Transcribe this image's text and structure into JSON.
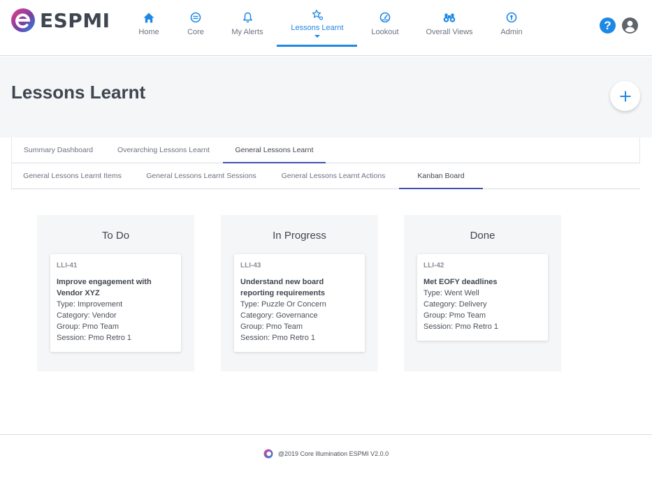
{
  "app": {
    "name": "ESPMI"
  },
  "nav": {
    "items": [
      {
        "label": "Home",
        "icon": "home-icon"
      },
      {
        "label": "Core",
        "icon": "core-icon"
      },
      {
        "label": "My Alerts",
        "icon": "bell-icon"
      },
      {
        "label": "Lessons Learnt",
        "icon": "lessons-learnt-icon",
        "active": true
      },
      {
        "label": "Lookout",
        "icon": "gauge-icon"
      },
      {
        "label": "Overall Views",
        "icon": "binoculars-icon"
      },
      {
        "label": "Admin",
        "icon": "admin-key-icon"
      }
    ],
    "help_icon": "help-icon",
    "help_glyph": "?",
    "user_icon": "user-avatar-icon"
  },
  "page": {
    "title": "Lessons Learnt",
    "add_icon": "plus-icon"
  },
  "tabs": {
    "primary": [
      "Summary Dashboard",
      "Overarching Lessons Learnt",
      "General Lessons Learnt"
    ],
    "primary_active": "General Lessons Learnt",
    "secondary": [
      "General Lessons Learnt Items",
      "General Lessons Learnt Sessions",
      "General Lessons Learnt Actions",
      "Kanban Board"
    ],
    "secondary_active": "Kanban Board"
  },
  "kanban": {
    "columns": [
      {
        "title": "To Do",
        "cards": [
          {
            "id": "LLI-41",
            "title": "Improve engagement with Vendor XYZ",
            "type": "Type: Improvement",
            "category": "Category: Vendor",
            "group": "Group: Pmo Team",
            "session": "Session: Pmo Retro 1"
          }
        ]
      },
      {
        "title": "In Progress",
        "cards": [
          {
            "id": "LLI-43",
            "title": "Understand new board reporting requirements",
            "type": "Type: Puzzle Or Concern",
            "category": "Category: Governance",
            "group": "Group: Pmo Team",
            "session": "Session: Pmo Retro 1"
          }
        ]
      },
      {
        "title": "Done",
        "cards": [
          {
            "id": "LLI-42",
            "title": "Met EOFY deadlines",
            "type": "Type: Went Well",
            "category": "Category: Delivery",
            "group": "Group: Pmo Team",
            "session": "Session: Pmo Retro 1"
          }
        ]
      }
    ]
  },
  "footer": {
    "text": "@2019 Core Illumination ESPMI V2.0.0",
    "logo_icon": "core-illumination-logo-icon"
  },
  "colors": {
    "accent": "#1e88e5",
    "tab_indicator": "#3f51b5",
    "text": "#3f4650",
    "page_bg": "#f5f6f8"
  }
}
